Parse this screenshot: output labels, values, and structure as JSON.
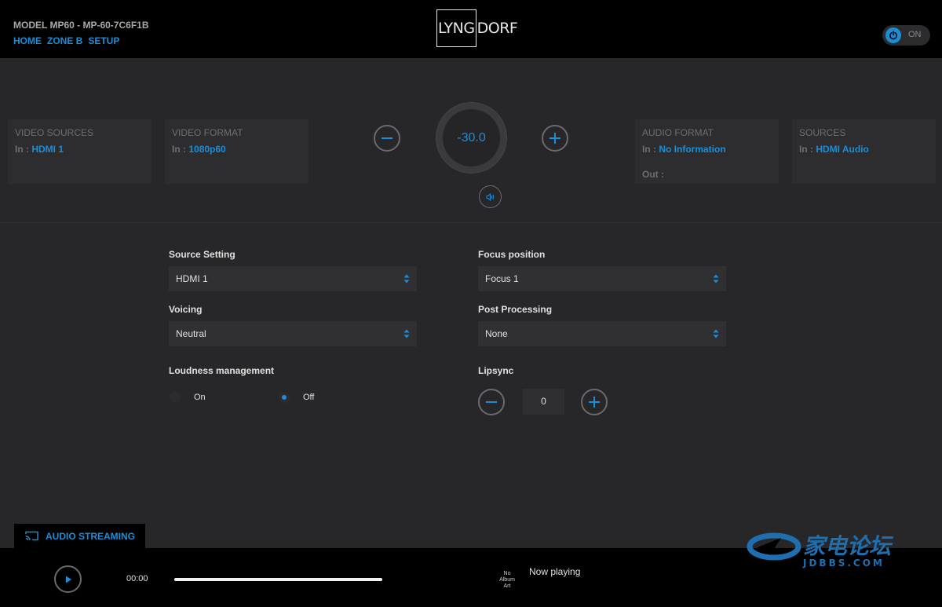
{
  "header": {
    "model": "MODEL MP60 - MP-60-7C6F1B",
    "nav": [
      "HOME",
      "ZONE B",
      "SETUP"
    ],
    "logo_left": "LYNG",
    "logo_right": "DORF",
    "power_label": "ON"
  },
  "cards": {
    "video_sources": {
      "title": "VIDEO SOURCES",
      "in_label": "In :",
      "in_value": "HDMI 1"
    },
    "video_format": {
      "title": "VIDEO FORMAT",
      "in_label": "In :",
      "in_value": "1080p60"
    },
    "audio_format": {
      "title": "AUDIO FORMAT",
      "in_label": "In :",
      "in_value": "No Information",
      "out_label": "Out :"
    },
    "sources": {
      "title": "SOURCES",
      "in_label": "In :",
      "in_value": "HDMI Audio"
    }
  },
  "volume": {
    "value": "-30.0"
  },
  "settings": {
    "source_setting": {
      "label": "Source Setting",
      "value": "HDMI 1"
    },
    "voicing": {
      "label": "Voicing",
      "value": "Neutral"
    },
    "loudness": {
      "label": "Loudness management",
      "on": "On",
      "off": "Off",
      "selected": "Off"
    },
    "focus_position": {
      "label": "Focus position",
      "value": "Focus 1"
    },
    "post_processing": {
      "label": "Post Processing",
      "value": "None"
    },
    "lipsync": {
      "label": "Lipsync",
      "value": "0"
    }
  },
  "streaming_tab": {
    "label": "AUDIO STREAMING"
  },
  "player": {
    "time": "00:00",
    "album_art": "No Album Art",
    "now_playing": "Now playing"
  },
  "watermark": {
    "text": "家电论坛",
    "domain": "JDBBS.COM"
  },
  "colors": {
    "accent": "#1a8ed8",
    "background": "#272729",
    "bar": "#000000"
  }
}
